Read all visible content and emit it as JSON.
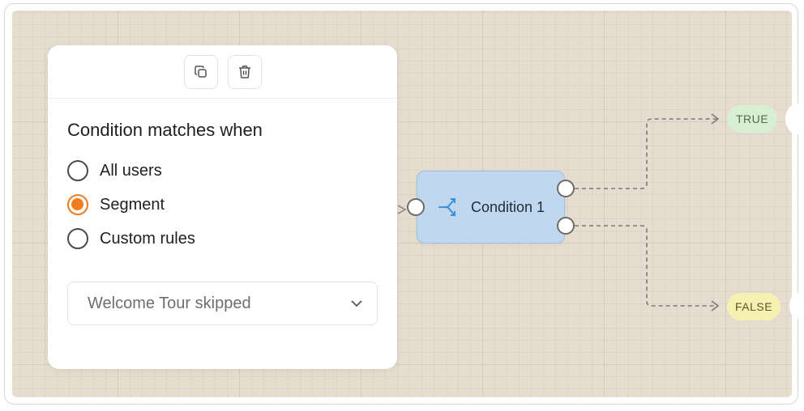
{
  "panel": {
    "title": "Condition matches when",
    "options": [
      {
        "label": "All users",
        "selected": false
      },
      {
        "label": "Segment",
        "selected": true
      },
      {
        "label": "Custom rules",
        "selected": false
      }
    ],
    "segment_select": {
      "value": "Welcome Tour skipped"
    },
    "toolbar": {
      "icons": [
        "copy-icon",
        "trash-icon"
      ]
    }
  },
  "node": {
    "label": "Condition 1",
    "icon": "split-arrows-icon"
  },
  "branches": {
    "true_label": "TRUE",
    "false_label": "FALSE"
  },
  "colors": {
    "canvas": "#e6ddd0",
    "node_fill": "#bfd8ef",
    "node_icon": "#3d8ed6",
    "radio_selected": "#f47c20",
    "true_badge": "#d8efd2",
    "false_badge": "#f6f1b1"
  }
}
